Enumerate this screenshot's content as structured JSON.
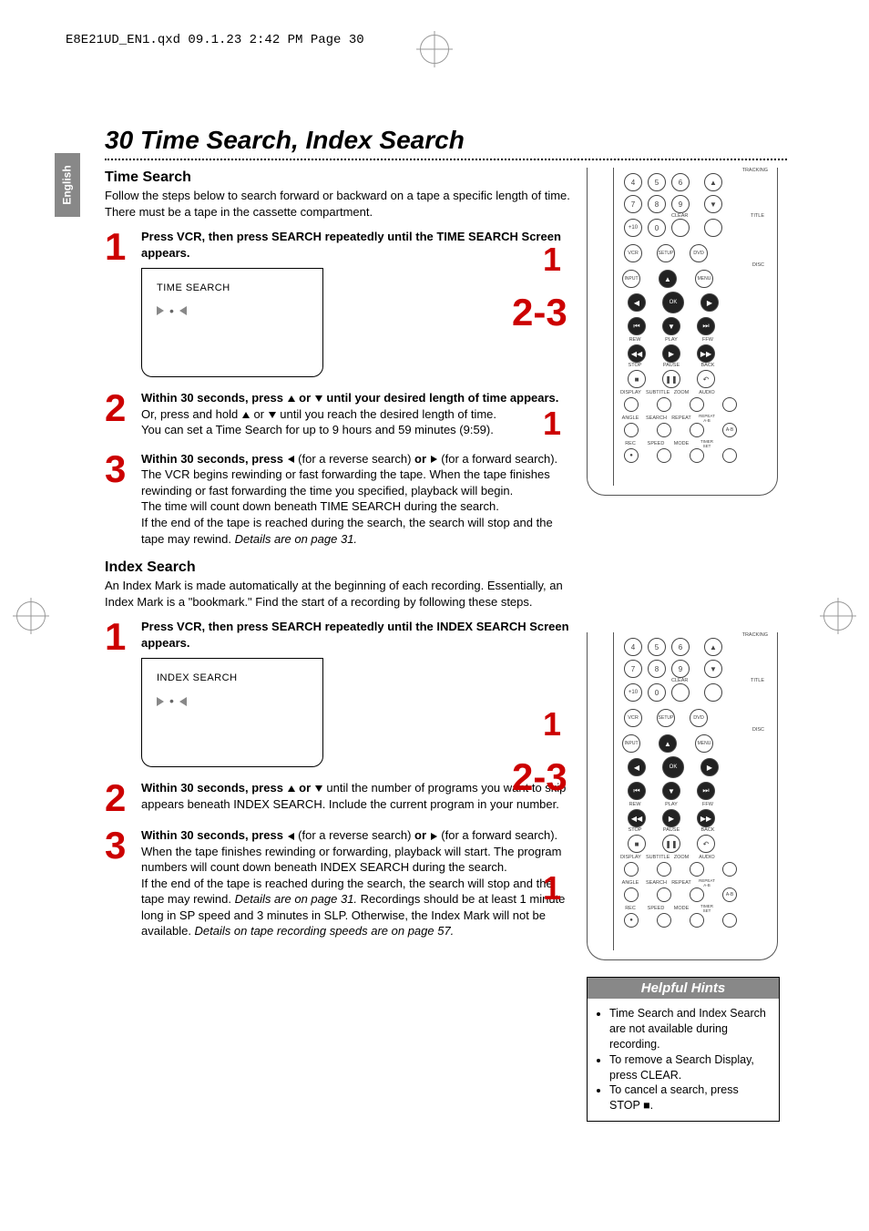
{
  "header_meta": "E8E21UD_EN1.qxd  09.1.23  2:42 PM  Page 30",
  "side_tab": "English",
  "page_title": "30 Time Search, Index Search",
  "sections": {
    "time_search": {
      "heading": "Time Search",
      "intro": "Follow the steps below to search forward or backward on a tape a specific length of time. There must be a tape in the cassette compartment.",
      "steps": [
        {
          "num": "1",
          "html": "<b>Press VCR, then press SEARCH repeatedly until the TIME SEARCH Screen appears.</b>",
          "osd_title": "TIME SEARCH"
        },
        {
          "num": "2",
          "html": "<b>Within 30 seconds, press <span class=\"tri-up\"></span> or <span class=\"tri-down\"></span> until your desired length of time appears.</b> Or, press and hold <span class=\"tri-up\"></span> or <span class=\"tri-down\"></span> until you reach the desired length of time.<br>You can set a Time Search for up to 9 hours and 59 minutes (9:59)."
        },
        {
          "num": "3",
          "html": "<b>Within 30 seconds, press <span class=\"tri-l\"></span></b> (for a reverse search) <b>or <span class=\"tri-r\"></span></b> (for a forward search). The VCR begins rewinding or fast forwarding the tape. When the tape finishes rewinding or fast forwarding the time you specified, playback will begin.<br>The time will count down beneath TIME SEARCH during the search.<br>If the end of the tape is reached during the search, the search will stop and the tape may rewind. <i>Details are on page 31.</i>"
        }
      ]
    },
    "index_search": {
      "heading": "Index Search",
      "intro": "An Index Mark is made automatically at the beginning of each recording. Essentially, an Index Mark is a \"bookmark.\" Find the start of a recording by following these steps.",
      "steps": [
        {
          "num": "1",
          "html": "<b>Press VCR, then press SEARCH repeatedly until the INDEX SEARCH Screen appears.</b>",
          "osd_title": "INDEX SEARCH"
        },
        {
          "num": "2",
          "html": "<b>Within 30 seconds, press <span class=\"tri-up\"></span> or <span class=\"tri-down\"></span></b> until the number of programs you want to skip appears beneath INDEX SEARCH. Include the current program in your number."
        },
        {
          "num": "3",
          "html": "<b>Within 30 seconds, press <span class=\"tri-l\"></span></b> (for a reverse search) <b>or <span class=\"tri-r\"></span></b> (for a forward search). When the tape finishes rewinding or forwarding, playback will start. The program numbers will count down beneath INDEX SEARCH during the search.<br>If the end of the tape is reached during the search, the search will stop and the tape may rewind. <i>Details are on page 31.</i> Recordings should be at least 1 minute long in SP speed and 3 minutes in SLP. Otherwise, the Index Mark will not be available. <i>Details on tape recording speeds are on page 57.</i>"
        }
      ]
    }
  },
  "remote": {
    "numpad_row1": [
      "4",
      "5",
      "6"
    ],
    "numpad_row2": [
      "7",
      "8",
      "9"
    ],
    "numpad_row3": [
      "+10",
      "0"
    ],
    "source_row": [
      "VCR",
      "SETUP",
      "DVD"
    ],
    "input_label": "INPUT",
    "menu_label": "MENU",
    "ok_label": "OK",
    "transport_labels": [
      "REW",
      "PLAY",
      "FFW"
    ],
    "transport2_labels": [
      "STOP",
      "PAUSE",
      "BACK"
    ],
    "func_row1_labels": [
      "DISPLAY",
      "SUBTITLE",
      "ZOOM",
      "AUDIO"
    ],
    "func_row2_labels": [
      "ANGLE",
      "SEARCH",
      "REPEAT",
      "REPEAT A-B"
    ],
    "func_row3_labels": [
      "REC",
      "SPEED",
      "MODE",
      "TIMER SET"
    ],
    "tracking_label": "TRACKING",
    "clear_label": "CLEAR",
    "title_label": "TITLE",
    "disc_label": "DISC"
  },
  "callouts": {
    "c1": "1",
    "c23": "2-3",
    "c1b": "1"
  },
  "hints": {
    "title": "Helpful Hints",
    "items": [
      "Time Search and Index Search are not available during recording.",
      "To remove a Search Display, press CLEAR.",
      "To cancel a search, press STOP ■."
    ]
  }
}
